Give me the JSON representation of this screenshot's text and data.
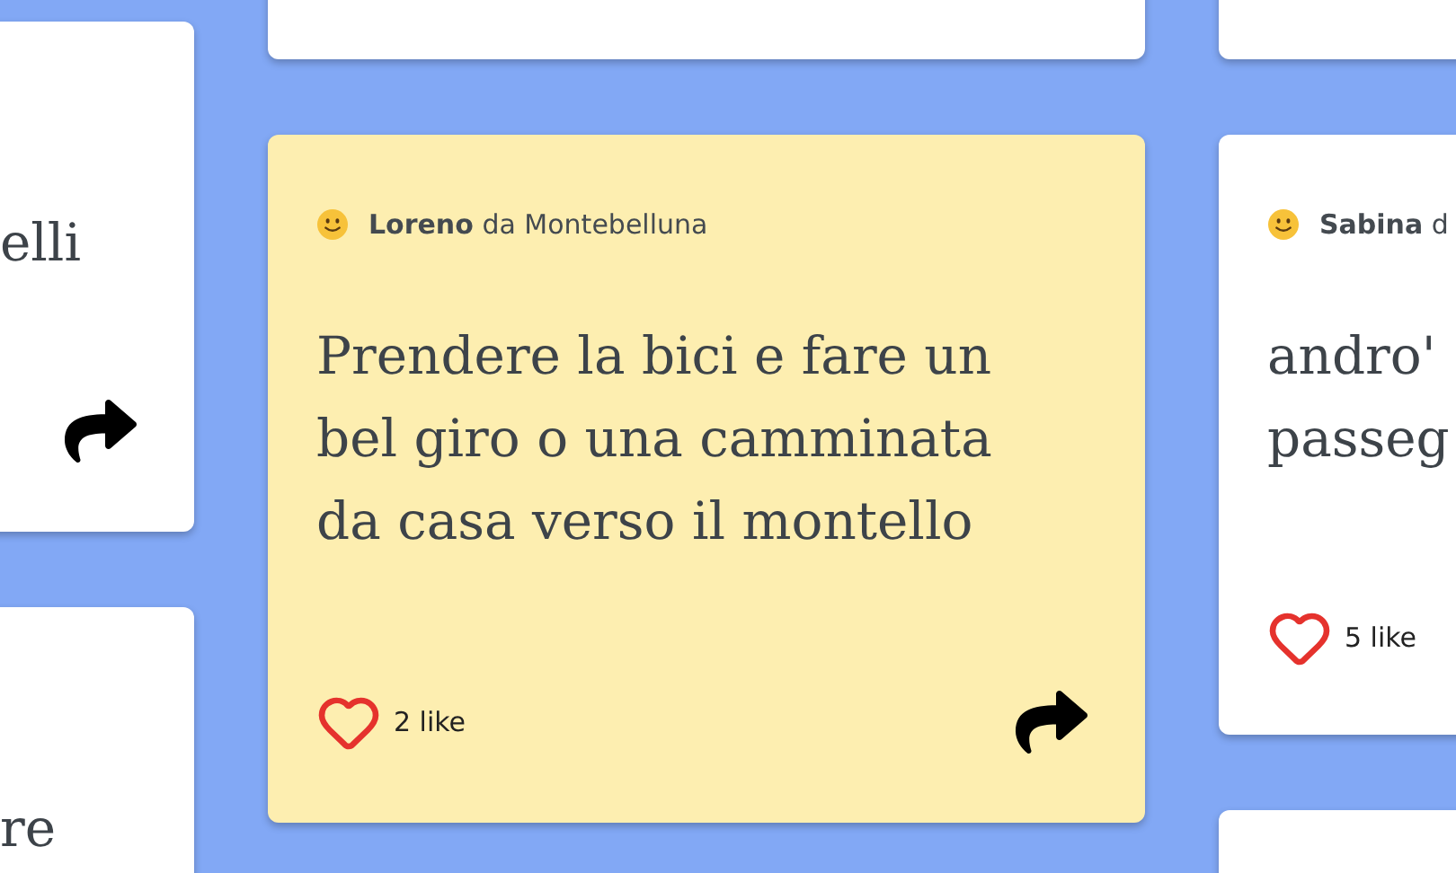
{
  "columns": [
    {
      "cards": [
        {
          "highlighted": false,
          "text": "elli",
          "share": true
        },
        {
          "highlighted": false,
          "text": "re",
          "share": false
        }
      ]
    },
    {
      "cards": [
        {
          "highlighted": false,
          "share": false
        },
        {
          "highlighted": true,
          "author": {
            "name": "Loreno",
            "place": "da Montebelluna"
          },
          "text": "Prendere la bici e fare un\nbel giro o una camminata\nda casa verso il montello",
          "likes": "2 like",
          "share": true
        }
      ]
    },
    {
      "cards": [
        {
          "highlighted": false,
          "share": false
        },
        {
          "highlighted": false,
          "author": {
            "name": "Sabina",
            "place": "d"
          },
          "text": "andro'\npasseg",
          "likes": "5 like",
          "share": false
        },
        {
          "highlighted": false,
          "share": false
        }
      ]
    }
  ]
}
